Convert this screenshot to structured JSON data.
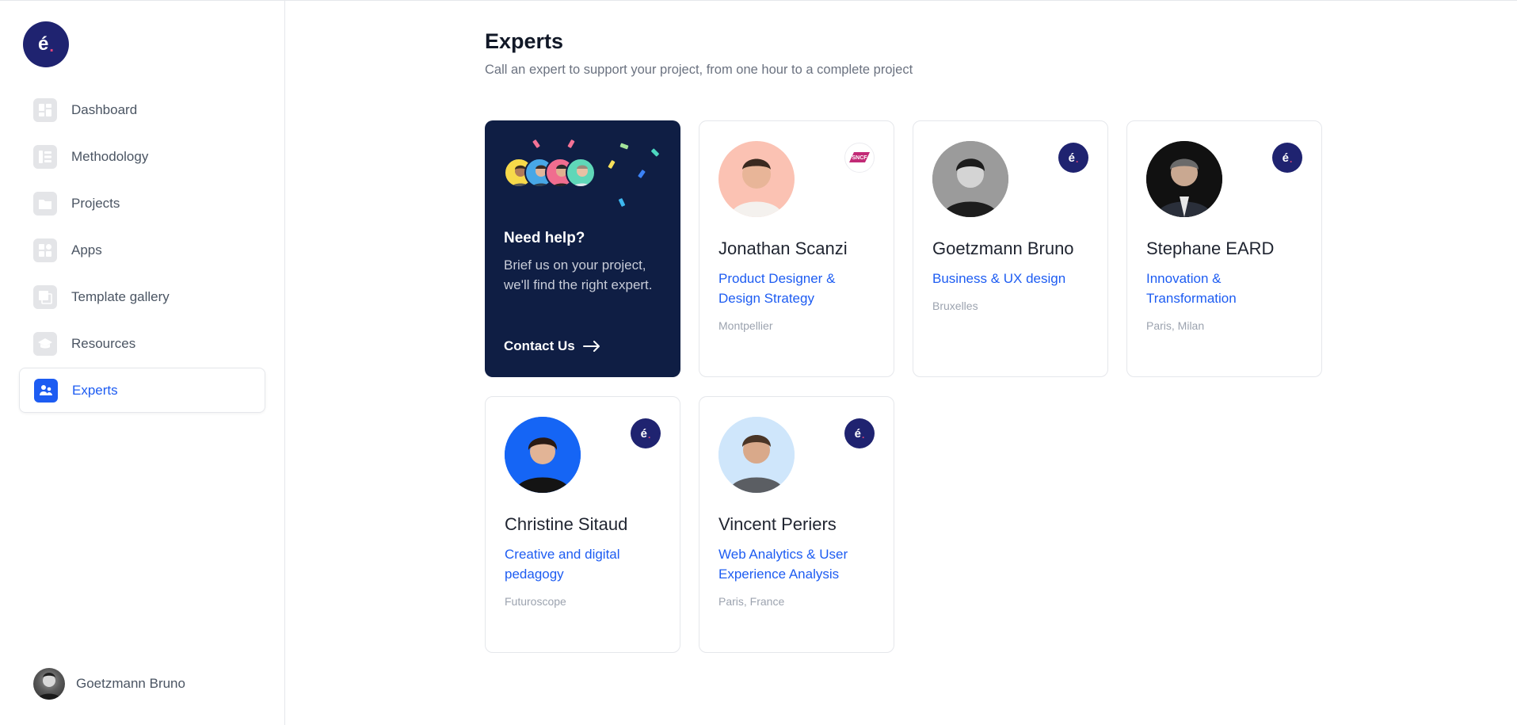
{
  "sidebar": {
    "logo": {
      "letter": "é",
      "dot": "."
    },
    "items": [
      {
        "label": "Dashboard",
        "icon": "dashboard-icon"
      },
      {
        "label": "Methodology",
        "icon": "methodology-icon"
      },
      {
        "label": "Projects",
        "icon": "projects-icon"
      },
      {
        "label": "Apps",
        "icon": "apps-icon"
      },
      {
        "label": "Template gallery",
        "icon": "template-gallery-icon"
      },
      {
        "label": "Resources",
        "icon": "resources-icon"
      },
      {
        "label": "Experts",
        "icon": "experts-icon",
        "active": true
      }
    ],
    "user": {
      "name": "Goetzmann Bruno"
    }
  },
  "main": {
    "title": "Experts",
    "subtitle": "Call an expert to support your project, from one hour to a complete project",
    "help_card": {
      "title": "Need help?",
      "description": "Brief us on your project, we'll find the right expert.",
      "cta": "Contact Us"
    },
    "experts": [
      {
        "name": "Jonathan Scanzi",
        "role": "Product Designer & Design Strategy",
        "location": "Montpellier",
        "badge": "sncf-logo"
      },
      {
        "name": "Goetzmann Bruno",
        "role": "Business & UX design",
        "location": "Bruxelles",
        "badge": "brand-logo"
      },
      {
        "name": "Stephane EARD",
        "role": "Innovation & Transformation",
        "location": "Paris, Milan",
        "badge": "brand-logo"
      },
      {
        "name": "Christine Sitaud",
        "role": "Creative and digital pedagogy",
        "location": "Futuroscope",
        "badge": "brand-logo"
      },
      {
        "name": "Vincent Periers",
        "role": "Web Analytics & User Experience Analysis",
        "location": "Paris, France",
        "badge": "brand-logo"
      }
    ]
  },
  "colors": {
    "accent": "#1d5cf2",
    "brand": "#1f2370",
    "help_card_bg": "#0f1e44"
  }
}
